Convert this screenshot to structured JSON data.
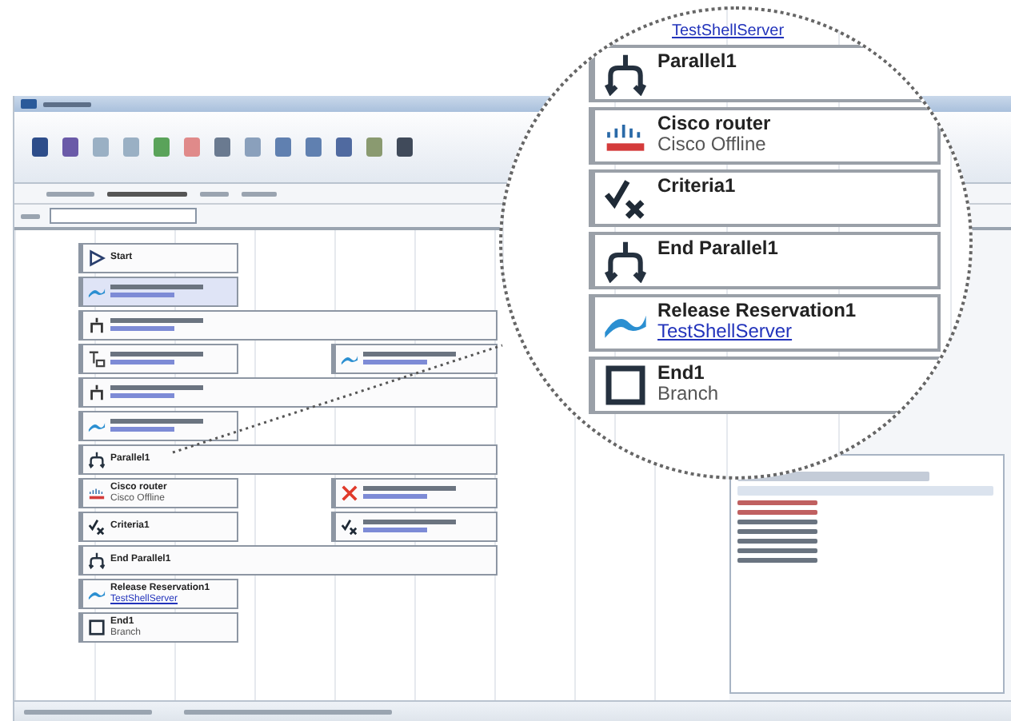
{
  "rows": [
    {
      "kind": "single",
      "nodes": [
        {
          "kind": "start",
          "title": "Start"
        }
      ]
    },
    {
      "kind": "single",
      "nodes": [
        {
          "kind": "reserve",
          "selected": true
        }
      ]
    },
    {
      "kind": "wide",
      "nodes": [
        {
          "kind": "check"
        }
      ]
    },
    {
      "kind": "split",
      "nodes": [
        {
          "kind": "config"
        },
        {
          "kind": "reserve"
        }
      ]
    },
    {
      "kind": "wide",
      "nodes": [
        {
          "kind": "check"
        }
      ]
    },
    {
      "kind": "single",
      "nodes": [
        {
          "kind": "reserve",
          "selected": false
        }
      ]
    },
    {
      "kind": "wide",
      "nodes": [
        {
          "kind": "parallel",
          "title": "Parallel1"
        }
      ]
    },
    {
      "kind": "split",
      "nodes": [
        {
          "kind": "cisco",
          "title": "Cisco router",
          "subtitle": "Cisco Offline"
        },
        {
          "kind": "fail"
        }
      ]
    },
    {
      "kind": "split",
      "nodes": [
        {
          "kind": "criteria",
          "title": "Criteria1"
        },
        {
          "kind": "criteria"
        }
      ]
    },
    {
      "kind": "wide",
      "nodes": [
        {
          "kind": "parallel",
          "title": "End Parallel1"
        }
      ]
    },
    {
      "kind": "single",
      "nodes": [
        {
          "kind": "reserve",
          "selected": false,
          "title": "Release Reservation1",
          "link": "TestShellServer"
        }
      ]
    },
    {
      "kind": "single",
      "nodes": [
        {
          "kind": "end",
          "title": "End1",
          "subtitle": "Branch"
        }
      ]
    }
  ],
  "magnifier": {
    "top_link": "TestShellServer",
    "nodes": [
      {
        "kind": "parallel",
        "title": "Parallel1"
      },
      {
        "kind": "cisco",
        "title": "Cisco router",
        "subtitle": "Cisco Offline"
      },
      {
        "kind": "criteria",
        "title": "Criteria1"
      },
      {
        "kind": "parallel",
        "title": "End Parallel1"
      },
      {
        "kind": "reserve",
        "title": "Release Reservation1",
        "link": "TestShellServer"
      },
      {
        "kind": "end",
        "title": "End1",
        "subtitle": "Branch"
      }
    ]
  }
}
